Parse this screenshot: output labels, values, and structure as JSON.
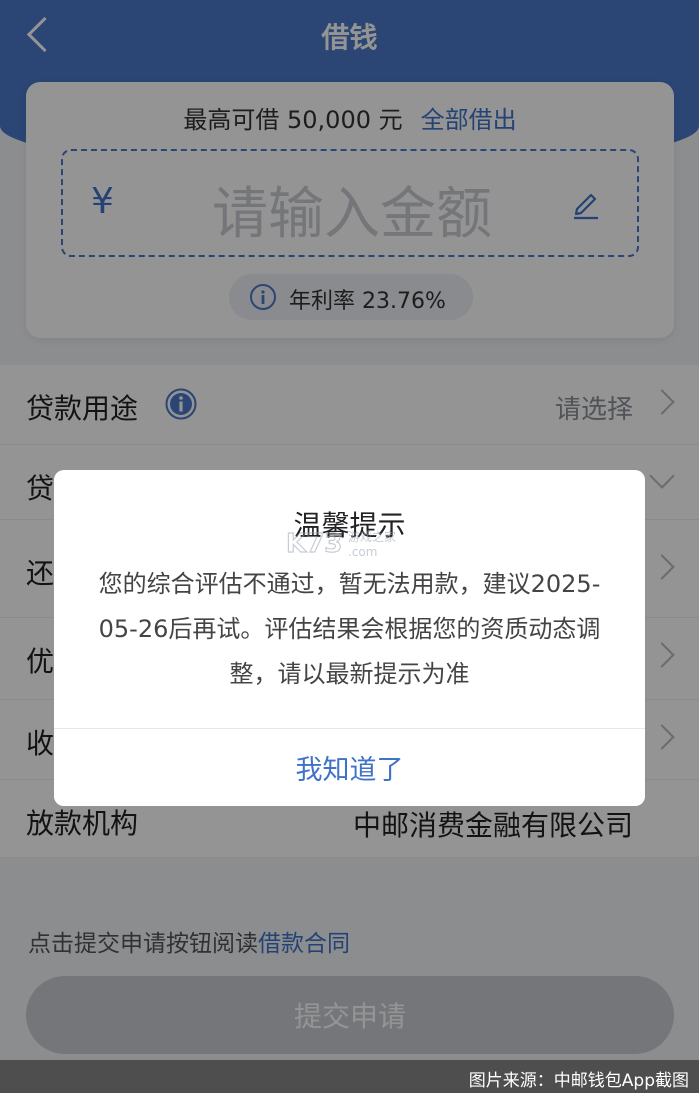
{
  "header": {
    "title": "借钱"
  },
  "amount_card": {
    "limit_text": "最高可借 50,000 元",
    "all_link": "全部借出",
    "currency_symbol": "¥",
    "amount_placeholder": "请输入金额",
    "rate_text": "年利率 23.76%"
  },
  "form": {
    "rows": [
      {
        "label": "贷款用途",
        "value": "请选择"
      },
      {
        "label": "贷"
      },
      {
        "label": "还"
      },
      {
        "label": "优"
      },
      {
        "label": "收"
      },
      {
        "label": "放款机构",
        "value": "中邮消费金融有限公司"
      }
    ]
  },
  "footer": {
    "notice_prefix": "点击提交申请按钮阅读",
    "notice_link": "借款合同",
    "submit_label": "提交申请"
  },
  "dialog": {
    "title": "温馨提示",
    "body": "您的综合评估不通过，暂无法用款，建议2025-05-26后再试。评估结果会根据您的资质动态调整，请以最新提示为准",
    "button_label": "我知道了",
    "watermark_text": "K73 游戏之家 .com"
  },
  "source_caption": "图片来源：中邮钱包App截图",
  "colors": {
    "brand": "#4a78c9",
    "link": "#3f72c8",
    "disabled": "#c9ccd3"
  }
}
